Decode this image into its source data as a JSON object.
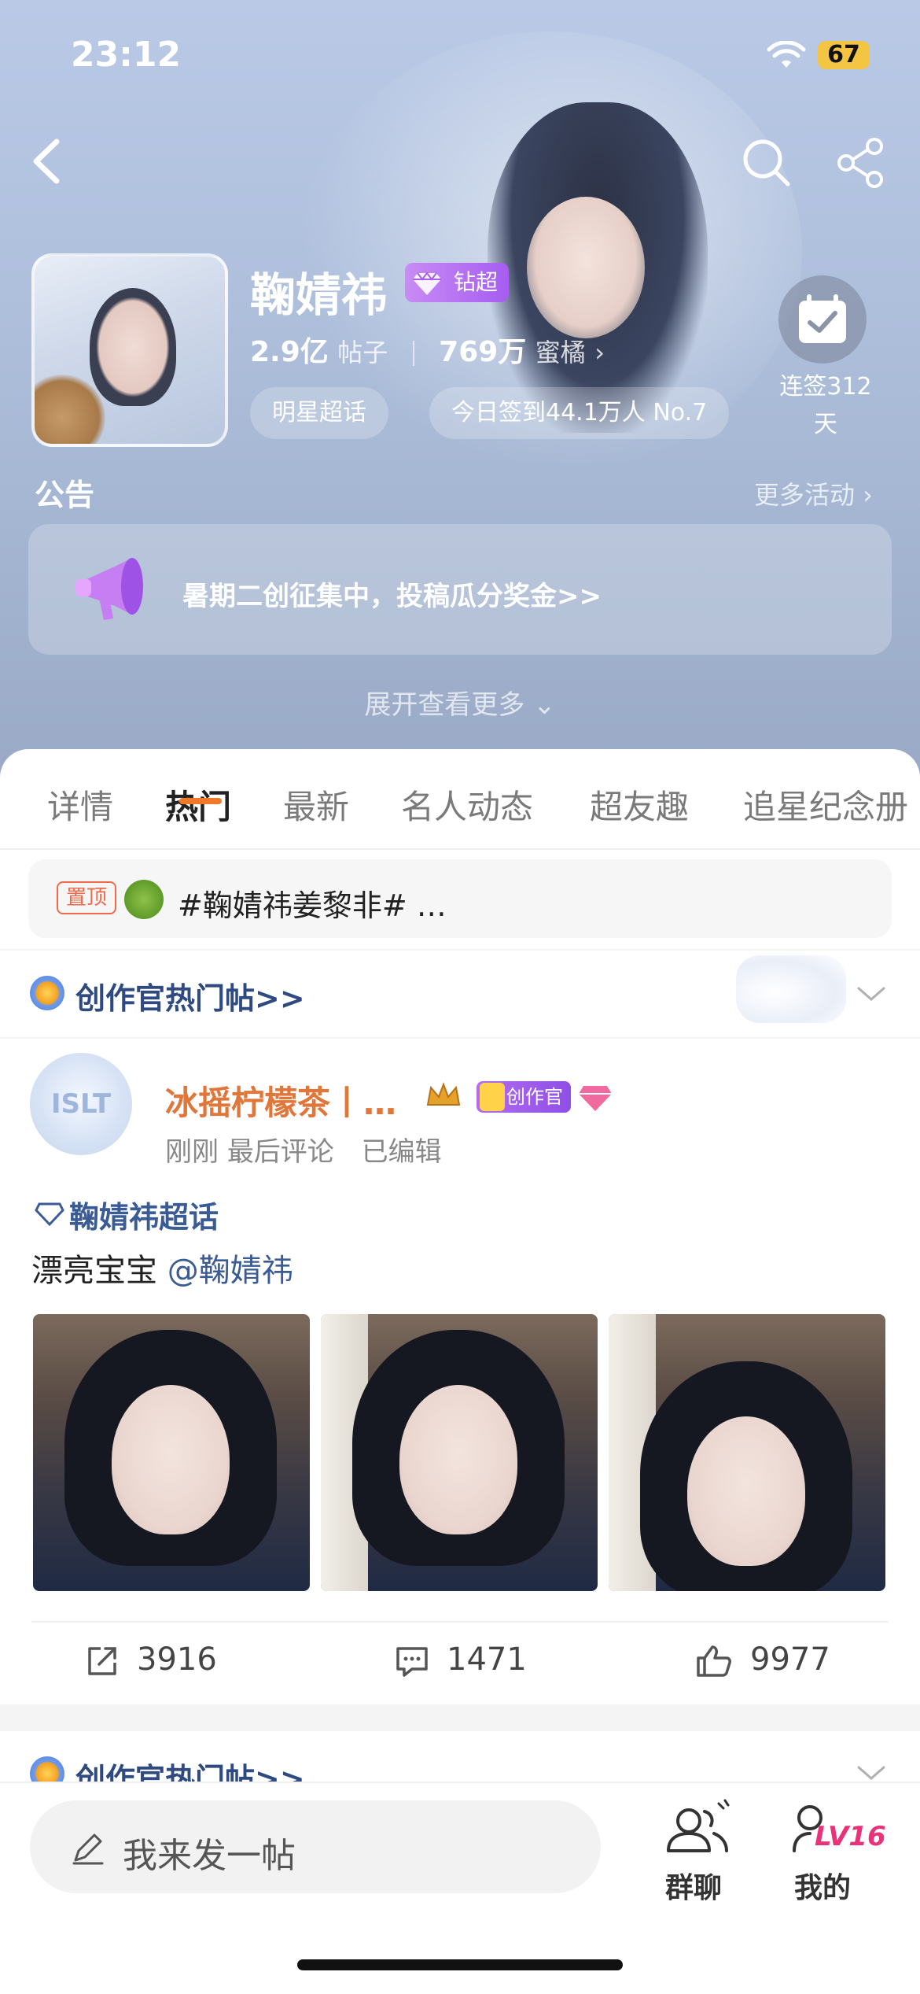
{
  "status_bar": {
    "time": "23:12",
    "battery": "67"
  },
  "profile": {
    "name": "鞠婧祎",
    "badge": "钻超",
    "posts_count": "2.9亿",
    "posts_label": "帖子",
    "fans_count": "769万",
    "fans_label": "蜜橘",
    "tags": [
      "明星超话",
      "今日签到44.1万人 No.7"
    ],
    "checkin_line1": "连签312",
    "checkin_line2": "天"
  },
  "notice": {
    "title": "公告",
    "more_link": "更多活动",
    "text": "暑期二创征集中，投稿瓜分奖金>>",
    "expand": "展开查看更多"
  },
  "tabs": [
    "详情",
    "热门",
    "最新",
    "名人动态",
    "超友趣",
    "追星纪念册"
  ],
  "active_tab": "热门",
  "pinned": {
    "tag": "置顶",
    "text": "#鞠婧祎姜黎非# …"
  },
  "creator_section": {
    "label": "创作官热门帖>>"
  },
  "post": {
    "author": "冰摇柠檬茶丨…",
    "avatar_text": "ISLT",
    "creator_badge": "创作官",
    "time": "刚刚",
    "last_comment": "最后评论",
    "edited": "已编辑",
    "topic": "鞠婧祎超话",
    "text": "漂亮宝宝",
    "mention": "@鞠婧祎",
    "reposts": "3916",
    "comments": "1471",
    "likes": "9977"
  },
  "bottom_nav": {
    "compose_placeholder": "我来发一帖",
    "group_chat": "群聊",
    "mine": "我的",
    "level": "LV16"
  },
  "colors": {
    "accent": "#f07a2a",
    "link": "#3a5b94",
    "author": "#e0763a",
    "badge_purple": "#a65df0"
  }
}
